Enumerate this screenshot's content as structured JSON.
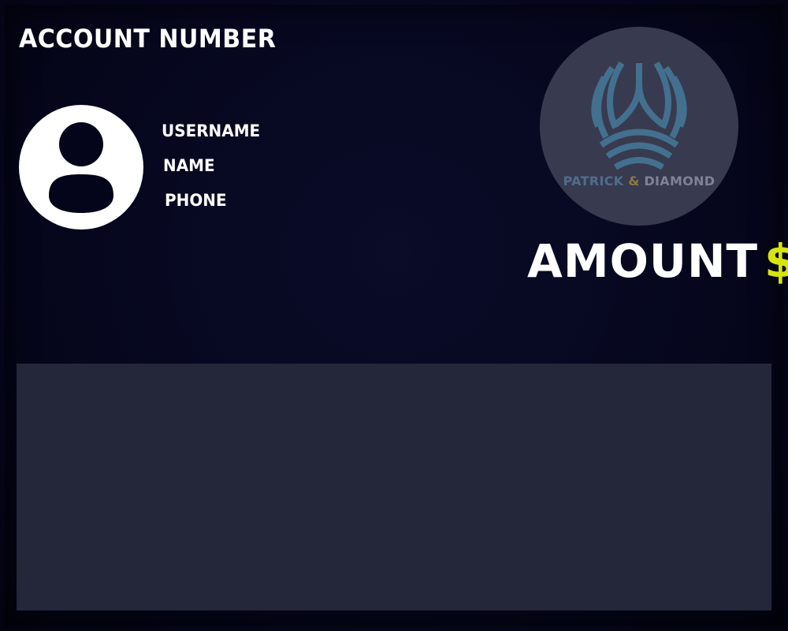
{
  "header": {
    "account_number_label": "ACCOUNT NUMBER"
  },
  "profile": {
    "avatar_icon": "user-avatar-icon",
    "username_label": "USERNAME",
    "name_label": "NAME",
    "phone_label": "PHONE"
  },
  "logo": {
    "name_part1": "PATRICK",
    "ampersand": "&",
    "name_part2": "DIAMOND",
    "colors": {
      "circle": "#383a4f",
      "arcs": "#43708f",
      "text_primary": "#4f6d8e",
      "ampersand": "#8a7a45",
      "text_secondary": "#7f8395"
    }
  },
  "amount": {
    "label": "AMOUNT",
    "currency_symbol": "$",
    "currency_color": "#d7e40d"
  },
  "colors": {
    "background": "#04051a",
    "panel": "#242639",
    "text": "#ffffff"
  }
}
